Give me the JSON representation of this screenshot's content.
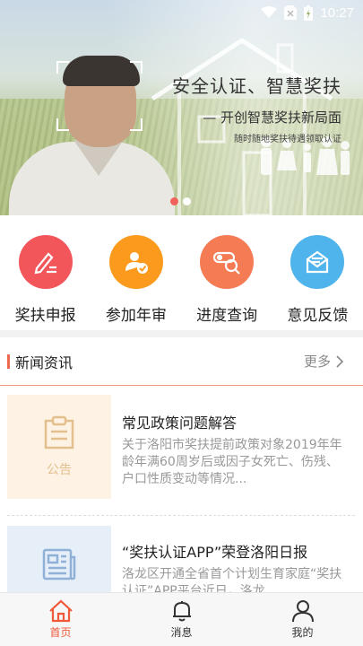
{
  "status": {
    "time": "10:27"
  },
  "banner": {
    "slogan": "安全认证、智慧奖扶",
    "subslogan": "— 开创智慧奖扶新局面",
    "subsmall": "随时随地奖扶待遇领取认证"
  },
  "actions": [
    {
      "label": "奖扶申报",
      "color": "#f2555a",
      "icon": "edit-form-icon"
    },
    {
      "label": "参加年审",
      "color": "#fb9a1c",
      "icon": "user-check-icon"
    },
    {
      "label": "进度查询",
      "color": "#f47b54",
      "icon": "search-progress-icon"
    },
    {
      "label": "意见反馈",
      "color": "#4fb3ec",
      "icon": "mail-icon"
    }
  ],
  "news": {
    "title": "新闻资讯",
    "more": "更多",
    "items": [
      {
        "tag": "公告",
        "title": "常见政策问题解答",
        "desc": "关于洛阳市奖扶提前政策对象2019年年龄年满60周岁后或因子女死亡、伤残、户口性质变动等情况..."
      },
      {
        "tag": "新闻",
        "title": "“奖扶认证APP”荣登洛阳日报",
        "desc": "洛龙区开通全省首个计划生育家庭“奖扶认证”APP平台近日，洛龙"
      }
    ]
  },
  "tabs": [
    {
      "label": "首页",
      "icon": "home-icon"
    },
    {
      "label": "消息",
      "icon": "bell-icon"
    },
    {
      "label": "我的",
      "icon": "user-icon"
    }
  ]
}
